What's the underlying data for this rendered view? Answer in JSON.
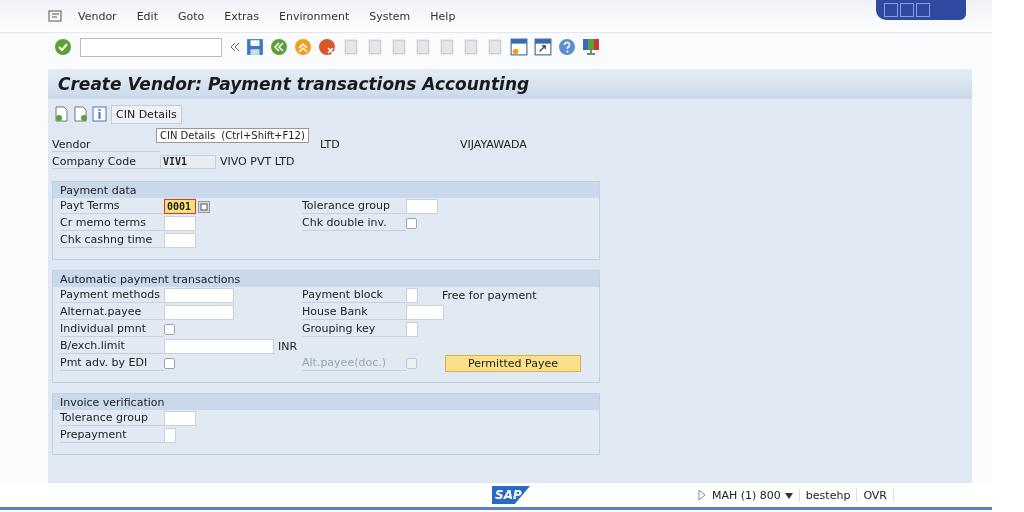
{
  "menu": [
    "Vendor",
    "Edit",
    "Goto",
    "Extras",
    "Environment",
    "System",
    "Help"
  ],
  "title": "Create Vendor: Payment transactions Accounting",
  "app_toolbar": {
    "button": "CIN Details"
  },
  "tooltip": {
    "text": "CIN Details",
    "shortcut": "(Ctrl+Shift+F12)"
  },
  "header": [
    {
      "label": "Vendor",
      "name": "LTD",
      "city": "VIJAYAWADA"
    },
    {
      "label": "Company Code",
      "value": "VIV1",
      "name": "VIVO PVT LTD"
    }
  ],
  "sections": [
    {
      "title": "Payment data",
      "rows": [
        [
          {
            "label": "Payt Terms",
            "field": {
              "kind": "code",
              "value": "0001",
              "focused": true,
              "help": true
            }
          },
          {
            "label": "Tolerance group",
            "field": {
              "kind": "code"
            }
          }
        ],
        [
          {
            "label": "Cr memo terms",
            "field": {
              "kind": "code"
            }
          },
          {
            "label": "Chk double inv.",
            "field": {
              "kind": "checkbox",
              "checked": false
            }
          }
        ],
        [
          {
            "label": "Chk cashng time",
            "field": {
              "kind": "code"
            }
          }
        ]
      ]
    },
    {
      "title": "Automatic payment transactions",
      "rows": [
        [
          {
            "label": "Payment methods",
            "field": {
              "kind": "text"
            }
          },
          {
            "label": "Payment block",
            "field": {
              "kind": "key"
            },
            "note": "Free for payment"
          }
        ],
        [
          {
            "label": "Alternat.payee",
            "field": {
              "kind": "text"
            }
          },
          {
            "label": "House Bank",
            "field": {
              "kind": "id"
            }
          }
        ],
        [
          {
            "label": "Individual pmnt",
            "field": {
              "kind": "checkbox",
              "checked": false
            }
          },
          {
            "label": "Grouping key",
            "field": {
              "kind": "key"
            }
          }
        ],
        [
          {
            "label": "B/exch.limit",
            "field": {
              "kind": "amount"
            },
            "note": "INR"
          }
        ],
        [
          {
            "label": "Pmt adv. by EDI",
            "field": {
              "kind": "checkbox",
              "checked": false
            }
          },
          {
            "label": "Alt.payee(doc.)",
            "disabled": true,
            "field": {
              "kind": "checkbox",
              "checked": false
            },
            "button": "Permitted Payee"
          }
        ]
      ]
    },
    {
      "title": "Invoice verification",
      "rows": [
        [
          {
            "label": "Tolerance group",
            "field": {
              "kind": "code"
            }
          }
        ],
        [
          {
            "label": "Prepayment",
            "field": {
              "kind": "key"
            }
          }
        ]
      ]
    }
  ],
  "status_bar": {
    "logo": "SAP",
    "system": "MAH (1) 800",
    "server": "bestehp",
    "mode": "OVR"
  }
}
